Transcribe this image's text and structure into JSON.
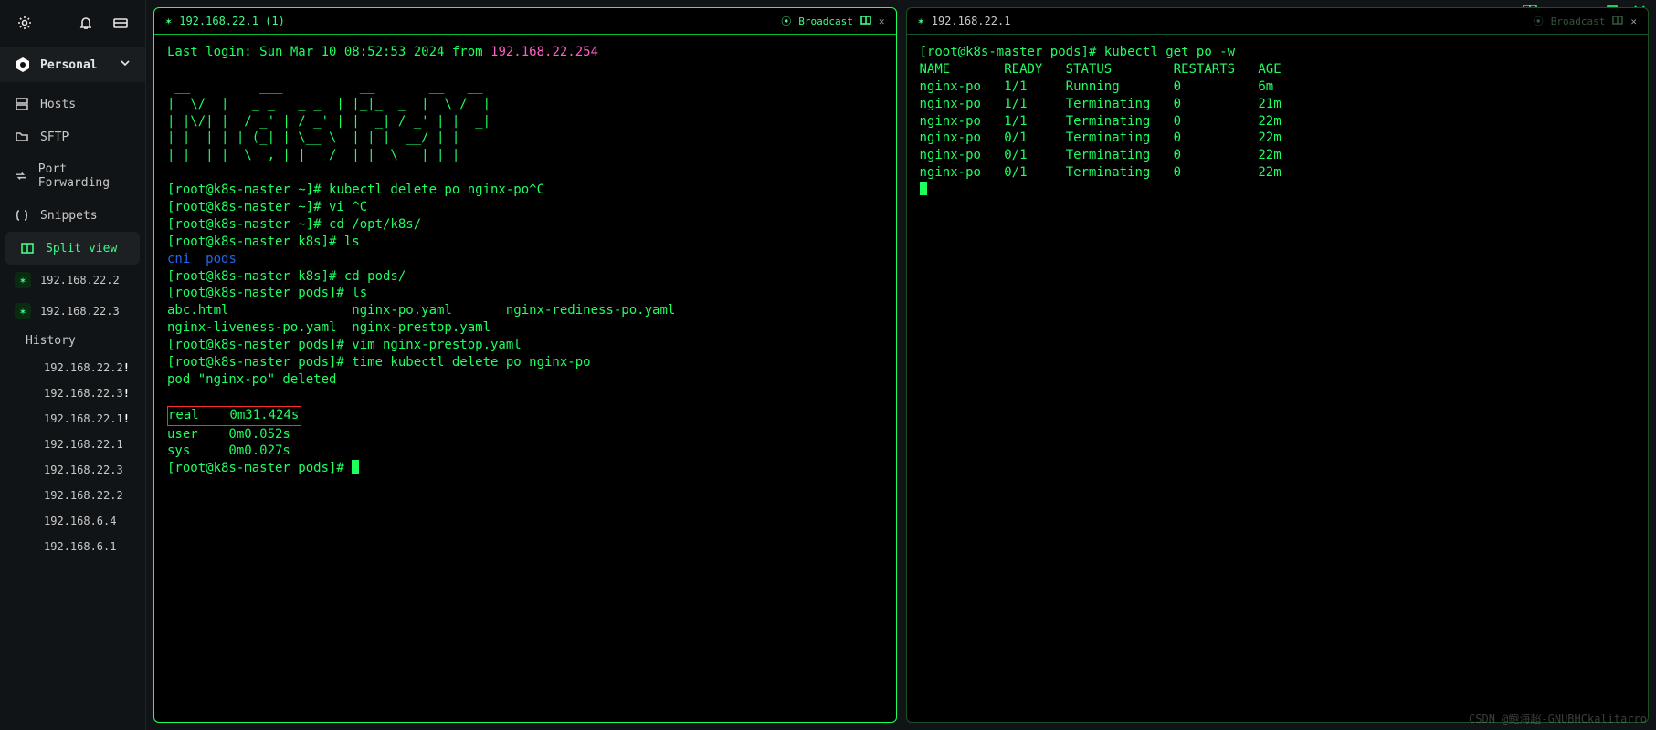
{
  "workspace": {
    "label": "Personal"
  },
  "nav": {
    "hosts": "Hosts",
    "sftp": "SFTP",
    "pf": "Port Forwarding",
    "snippets": "Snippets",
    "split": "Split view"
  },
  "hosts": [
    {
      "ip": "192.168.22.2"
    },
    {
      "ip": "192.168.22.3"
    }
  ],
  "history": {
    "label": "History",
    "items": [
      {
        "ip": "192.168.22.2",
        "warn": "!"
      },
      {
        "ip": "192.168.22.3",
        "warn": "!"
      },
      {
        "ip": "192.168.22.1",
        "warn": "!"
      },
      {
        "ip": "192.168.22.1",
        "warn": ""
      },
      {
        "ip": "192.168.22.3",
        "warn": ""
      },
      {
        "ip": "192.168.22.2",
        "warn": ""
      },
      {
        "ip": "192.168.6.4",
        "warn": ""
      },
      {
        "ip": "192.168.6.1",
        "warn": ""
      }
    ]
  },
  "broadcast": "Broadcast",
  "leftPane": {
    "title": "192.168.22.1 (1)",
    "lastLoginPrefix": "Last login: Sun Mar 10 08:52:53 2024 from ",
    "lastLoginIp": "192.168.22.254",
    "ascii1": " __         ___          __       __   __  ",
    "ascii2": "|  \\/  |   _ _   _ _  | |_|_  _  |  \\ /  | ",
    "ascii3": "| |\\/| |  / _' | / _' | |  _| / _' | |  _| ",
    "ascii4": "| |  | | | (_| | \\__ \\  | | |  __/ | |  ",
    "ascii5": "|_|  |_|  \\__,_| |___/  |_|  \\___| |_|  ",
    "l6": "[root@k8s-master ~]# kubectl delete po nginx-po^C",
    "l7": "[root@k8s-master ~]# vi ^C",
    "l8": "[root@k8s-master ~]# cd /opt/k8s/",
    "l9": "[root@k8s-master k8s]# ls",
    "l10a": "cni  ",
    "l10b": "pods",
    "l11": "[root@k8s-master k8s]# cd pods/",
    "l12": "[root@k8s-master pods]# ls",
    "l13": "abc.html                nginx-po.yaml       nginx-rediness-po.yaml",
    "l14": "nginx-liveness-po.yaml  nginx-prestop.yaml",
    "l15": "[root@k8s-master pods]# vim nginx-prestop.yaml",
    "l16": "[root@k8s-master pods]# time kubectl delete po nginx-po",
    "l17": "pod \"nginx-po\" deleted",
    "blank": "",
    "realLine": "real    0m31.424s",
    "l19": "user    0m0.052s",
    "l20": "sys     0m0.027s",
    "l21": "[root@k8s-master pods]# "
  },
  "rightPane": {
    "title": "192.168.22.1",
    "cmd": "[root@k8s-master pods]# kubectl get po -w",
    "header": "NAME       READY   STATUS        RESTARTS   AGE",
    "rows": [
      "nginx-po   1/1     Running       0          6m",
      "nginx-po   1/1     Terminating   0          21m",
      "nginx-po   1/1     Terminating   0          22m",
      "nginx-po   0/1     Terminating   0          22m",
      "nginx-po   0/1     Terminating   0          22m",
      "nginx-po   0/1     Terminating   0          22m"
    ]
  },
  "watermark": "CSDN @鲍海超-GNUBHCkalitarro"
}
